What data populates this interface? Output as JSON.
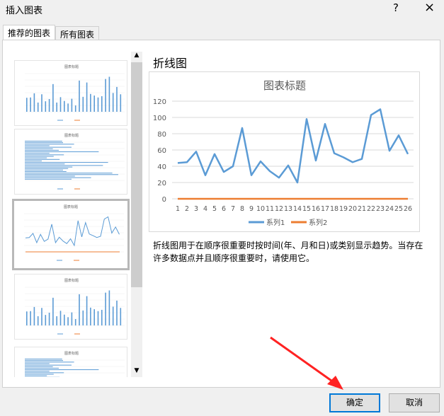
{
  "window": {
    "title": "插入图表",
    "help": "?",
    "close": "×"
  },
  "tabs": [
    {
      "label": "推荐的图表"
    },
    {
      "label": "所有图表"
    }
  ],
  "preview": {
    "chart_type": "折线图",
    "description": "折线图用于在顺序很重要时按时间(年、月和日)或类别显示趋势。当存在许多数据点并且顺序很重要时，请使用它。"
  },
  "buttons": {
    "ok": "确定",
    "cancel": "取消"
  },
  "thumbnails": [
    {
      "type": "column",
      "title": "图表标题"
    },
    {
      "type": "bar",
      "title": "图表标题"
    },
    {
      "type": "line",
      "title": "图表标题",
      "selected": true
    },
    {
      "type": "column",
      "title": "图表标题"
    },
    {
      "type": "bar",
      "title": "图表标题"
    }
  ],
  "chart_data": {
    "type": "line",
    "title": "图表标题",
    "categories": [
      "1",
      "2",
      "3",
      "4",
      "5",
      "6",
      "7",
      "8",
      "9",
      "10",
      "11",
      "12",
      "13",
      "14",
      "15",
      "16",
      "17",
      "18",
      "19",
      "20",
      "21",
      "22",
      "23",
      "24",
      "25",
      "26"
    ],
    "series": [
      {
        "name": "系列1",
        "color": "#5b9bd5",
        "values": [
          44,
          45,
          58,
          29,
          55,
          33,
          40,
          87,
          29,
          46,
          34,
          26,
          41,
          20,
          98,
          47,
          92,
          56,
          51,
          45,
          49,
          103,
          110,
          59,
          78,
          55
        ]
      },
      {
        "name": "系列2",
        "color": "#ed7d31",
        "values": [
          0,
          0,
          0,
          0,
          0,
          0,
          0,
          0,
          0,
          0,
          0,
          0,
          0,
          0,
          0,
          0,
          0,
          0,
          0,
          0,
          0,
          0,
          0,
          0,
          0,
          0
        ]
      }
    ],
    "ylim": [
      0,
      120
    ],
    "yticks": [
      "0",
      "20",
      "40",
      "60",
      "80",
      "100",
      "120"
    ],
    "grid": true,
    "legend": "bottom"
  }
}
